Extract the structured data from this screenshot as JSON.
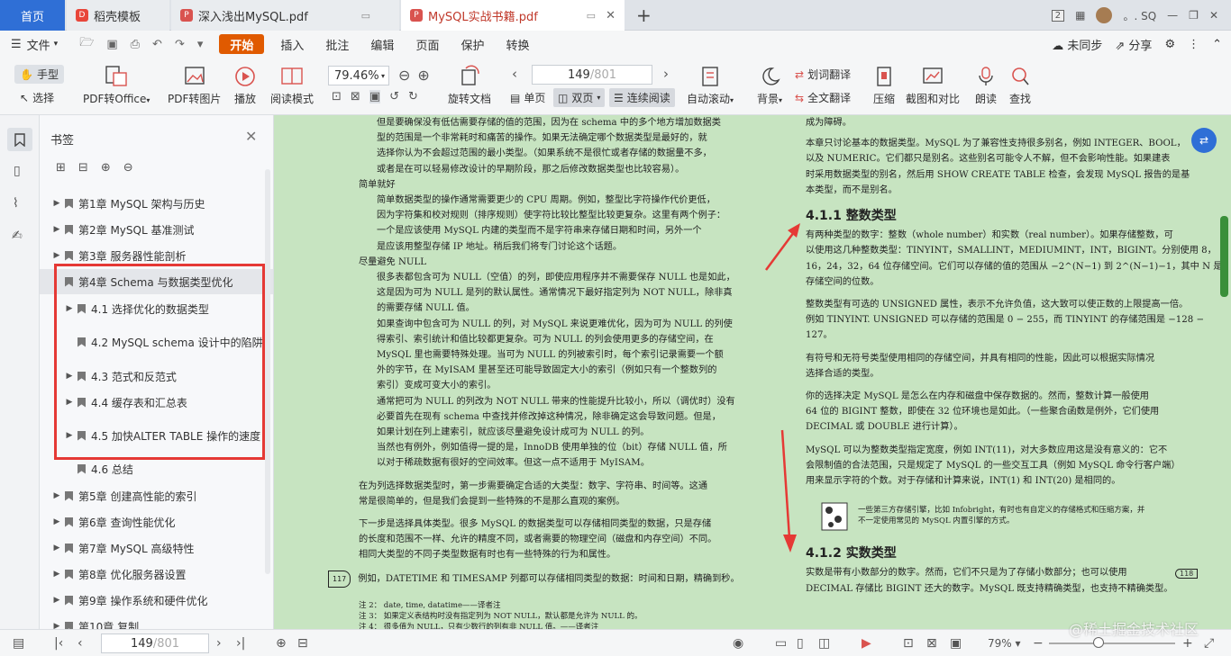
{
  "tabs": {
    "home": "首页",
    "t1": "稻壳模板",
    "t2": "深入浅出MySQL.pdf",
    "t3": "MySQL实战书籍.pdf",
    "count": "2",
    "user": "。. SQ"
  },
  "menu": {
    "file": "文件",
    "items": [
      "开始",
      "插入",
      "批注",
      "编辑",
      "页面",
      "保护",
      "转换"
    ],
    "sync": "未同步",
    "share": "分享"
  },
  "toolbar": {
    "hand": "手型",
    "select": "选择",
    "pdf_office": "PDF转Office",
    "pdf_image": "PDF转图片",
    "play": "播放",
    "read_mode": "阅读模式",
    "zoom": "79.46%",
    "page_input": "149",
    "page_total": "/801",
    "rotate": "旋转文档",
    "single": "单页",
    "double": "双页",
    "continuous": "连续阅读",
    "autoscroll": "自动滚动",
    "background": "背景",
    "word_translate": "划词翻译",
    "full_translate": "全文翻译",
    "compress": "压缩",
    "screenshot": "截图和对比",
    "read_aloud": "朗读",
    "search": "查找"
  },
  "sidebar": {
    "title": "书签",
    "items": [
      {
        "label": "第1章 MySQL 架构与历史",
        "level": 0,
        "arrow": true
      },
      {
        "label": "第2章 MySQL 基准测试",
        "level": 0,
        "arrow": true
      },
      {
        "label": "第3章 服务器性能剖析",
        "level": 0,
        "arrow": true
      },
      {
        "label": "第4章 Schema 与数据类型优化",
        "level": 0,
        "arrow": false,
        "selected": true
      },
      {
        "label": "4.1 选择优化的数据类型",
        "level": 1,
        "arrow": true
      },
      {
        "label": "4.2 MySQL schema 设计中的陷阱",
        "level": 1,
        "arrow": false
      },
      {
        "label": "4.3 范式和反范式",
        "level": 1,
        "arrow": true
      },
      {
        "label": "4.4 缓存表和汇总表",
        "level": 1,
        "arrow": true
      },
      {
        "label": "4.5 加快ALTER TABLE 操作的速度",
        "level": 1,
        "arrow": true
      },
      {
        "label": "4.6 总结",
        "level": 1,
        "arrow": false
      },
      {
        "label": "第5章 创建高性能的索引",
        "level": 0,
        "arrow": true
      },
      {
        "label": "第6章 查询性能优化",
        "level": 0,
        "arrow": true
      },
      {
        "label": "第7章 MySQL 高级特性",
        "level": 0,
        "arrow": true
      },
      {
        "label": "第8章 优化服务器设置",
        "level": 0,
        "arrow": true
      },
      {
        "label": "第9章 操作系统和硬件优化",
        "level": 0,
        "arrow": true
      },
      {
        "label": "第10章 复制",
        "level": 0,
        "arrow": true
      }
    ]
  },
  "left_page": {
    "lines": [
      {
        "t": "但是要确保没有低估需要存储的值的范围，因为在 schema 中的多个地方增加数据类",
        "i": 1
      },
      {
        "t": "型的范围是一个非常耗时和痛苦的操作。如果无法确定哪个数据类型是最好的，就",
        "i": 1
      },
      {
        "t": "选择你认为不会超过范围的最小类型。（如果系统不是很忙或者存储的数据量不多，",
        "i": 1
      },
      {
        "t": "或者是在可以轻易修改设计的早期阶段，那之后修改数据类型也比较容易）。",
        "i": 1
      },
      {
        "t": "简单就好",
        "i": 0
      },
      {
        "t": "简单数据类型的操作通常需要更少的 CPU 周期。例如，整型比字符操作代价更低，",
        "i": 1
      },
      {
        "t": "因为字符集和校对规则（排序规则）使字符比较比整型比较更复杂。这里有两个例子：",
        "i": 1
      },
      {
        "t": "一个是应该使用 MySQL 内建的类型而不是字符串来存储日期和时间，另外一个",
        "i": 1
      },
      {
        "t": "是应该用整型存储 IP 地址。稍后我们将专门讨论这个话题。",
        "i": 1
      },
      {
        "t": "尽量避免 NULL",
        "i": 0
      },
      {
        "t": "很多表都包含可为 NULL（空值）的列，即使应用程序并不需要保存 NULL 也是如此，",
        "i": 1
      },
      {
        "t": "这是因为可为 NULL 是列的默认属性。通常情况下最好指定列为 NOT NULL，除非真",
        "i": 1
      },
      {
        "t": "的需要存储 NULL 值。",
        "i": 1
      },
      {
        "t": "如果查询中包含可为 NULL 的列，对 MySQL 来说更难优化，因为可为 NULL 的列使",
        "i": 1
      },
      {
        "t": "得索引、索引统计和值比较都更复杂。可为 NULL 的列会使用更多的存储空间，在",
        "i": 1
      },
      {
        "t": "MySQL 里也需要特殊处理。当可为 NULL 的列被索引时，每个索引记录需要一个额",
        "i": 1
      },
      {
        "t": "外的字节，在 MyISAM 里甚至还可能导致固定大小的索引（例如只有一个整数列的",
        "i": 1
      },
      {
        "t": "索引）变成可变大小的索引。",
        "i": 1
      },
      {
        "t": "通常把可为 NULL 的列改为 NOT NULL 带来的性能提升比较小，所以（调优时）没有",
        "i": 1
      },
      {
        "t": "必要首先在现有 schema 中查找并修改掉这种情况，除非确定这会导致问题。但是，",
        "i": 1
      },
      {
        "t": "如果计划在列上建索引，就应该尽量避免设计成可为 NULL 的列。",
        "i": 1
      },
      {
        "t": "当然也有例外，例如值得一提的是，InnoDB 使用单独的位（bit）存储 NULL 值，所",
        "i": 1
      },
      {
        "t": "以对于稀疏数据有很好的空间效率。但这一点不适用于 MyISAM。",
        "i": 1
      },
      {
        "t": "在为列选择数据类型时，第一步需要确定合适的大类型：数字、字符串、时间等。这通",
        "i": 0
      },
      {
        "t": "常是很简单的，但是我们会提到一些特殊的不是那么直观的案例。",
        "i": 0
      },
      {
        "t": "下一步是选择具体类型。很多 MySQL 的数据类型可以存储相同类型的数据，只是存储",
        "i": 0
      },
      {
        "t": "的长度和范围不一样、允许的精度不同，或者需要的物理空间（磁盘和内存空间）不同。",
        "i": 0
      },
      {
        "t": "相同大类型的不同子类型数据有时也有一些特殊的行为和属性。",
        "i": 0
      },
      {
        "t": "例如，DATETIME 和 TIMESAMP 列都可以存储相同类型的数据：时间和日期，精确到秒。",
        "i": 0
      }
    ],
    "page_mark": "117",
    "notes": [
      "注 2：    date, time, datatime——译者注",
      "注 3：    如果定义表结构时没有指定列为 NOT NULL，默认都是允许为 NULL 的。",
      "注 4：    很多值为 NULL，只有少数行的列有非 NULL 值。——译者注"
    ]
  },
  "right_page": {
    "p1": [
      "成为障碍。",
      "本章只讨论基本的数据类型。MySQL 为了兼容性支持很多别名，例如 INTEGER、BOOL，",
      "以及 NUMERIC。它们都只是别名。这些别名可能令人不解，但不会影响性能。如果建表",
      "时采用数据类型的别名，然后用 SHOW CREATE TABLE 检查，会发现 MySQL 报告的是基",
      "本类型，而不是别名。"
    ],
    "h1": "4.1.1  整数类型",
    "p2": [
      "有两种类型的数字：整数（whole number）和实数（real number）。如果存储整数，可",
      "以使用这几种整数类型：TINYINT，SMALLINT，MEDIUMINT，INT，BIGINT。分别使用 8，",
      "16，24，32，64 位存储空间。它们可以存储的值的范围从 −2^(N−1) 到 2^(N−1)−1，其中 N 是",
      "存储空间的位数。"
    ],
    "p3": [
      "整数类型有可选的 UNSIGNED 属性，表示不允许负值，这大致可以使正数的上限提高一倍。",
      "例如 TINYINT. UNSIGNED 可以存储的范围是 0 − 255，而 TINYINT 的存储范围是 −128 −",
      "127。"
    ],
    "p4": [
      "有符号和无符号类型使用相同的存储空间，并具有相同的性能，因此可以根据实际情况",
      "选择合适的类型。"
    ],
    "p5": [
      "你的选择决定 MySQL 是怎么在内存和磁盘中保存数据的。然而，整数计算一般使用",
      "64 位的 BIGINT 整数，即使在 32 位环境也是如此。（一些聚合函数是例外，它们使用",
      "DECIMAL 或 DOUBLE 进行计算）。"
    ],
    "p6": [
      "MySQL 可以为整数类型指定宽度，例如 INT(11)，对大多数应用这是没有意义的：它不",
      "会限制值的合法范围，只是规定了 MySQL 的一些交互工具（例如 MySQL 命令行客户端）",
      "用来显示字符的个数。对于存储和计算来说，INT(1) 和 INT(20) 是相同的。"
    ],
    "note": [
      "一些第三方存储引擎，比如 Infobright，有时也有自定义的存储格式和压缩方案，并",
      "不一定使用常见的 MySQL 内置引擎的方式。"
    ],
    "h2": "4.1.2  实数类型",
    "page_mark": "118",
    "p7": [
      "实数是带有小数部分的数字。然而，它们不只是为了存储小数部分；也可以使用",
      "DECIMAL 存储比 BIGINT 还大的数字。MySQL 既支持精确类型，也支持不精确类型。"
    ]
  },
  "status": {
    "page_input": "149",
    "page_total": "/801",
    "zoom": "79%"
  },
  "watermark": "@稀土掘金技术社区",
  "colors": {
    "accent": "#e05a00",
    "tab_active": "#2f6fd6",
    "reader_bg": "#c7e4c1",
    "annotation_red": "#e53935"
  }
}
